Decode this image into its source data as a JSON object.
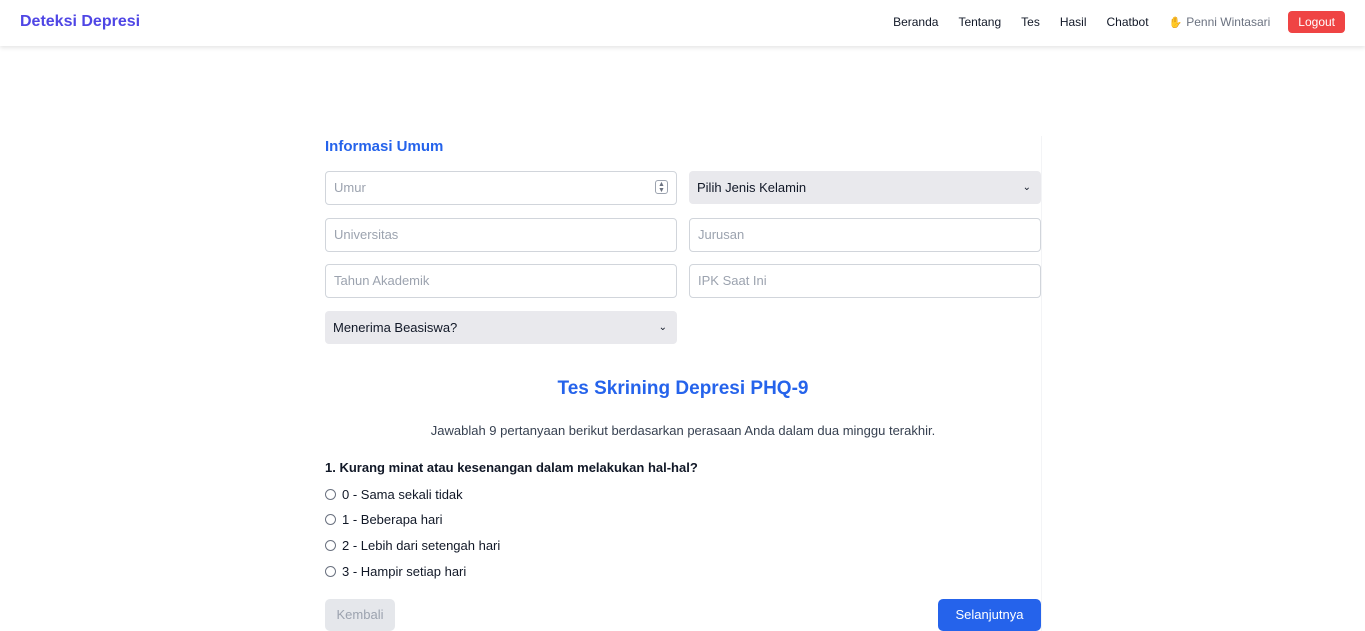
{
  "nav": {
    "brand": "Deteksi Depresi",
    "links": [
      "Beranda",
      "Tentang",
      "Tes",
      "Hasil",
      "Chatbot"
    ],
    "user": "Penni Wintasari",
    "user_icon": "waving-hand-icon",
    "logout": "Logout"
  },
  "form": {
    "section_title": "Informasi Umum",
    "age_placeholder": "Umur",
    "gender_select": "Pilih Jenis Kelamin",
    "university_placeholder": "Universitas",
    "major_placeholder": "Jurusan",
    "year_placeholder": "Tahun Akademik",
    "gpa_placeholder": "IPK Saat Ini",
    "scholarship_select": "Menerima Beasiswa?"
  },
  "test": {
    "title": "Tes Skrining Depresi PHQ-9",
    "description": "Jawablah 9 pertanyaan berikut berdasarkan perasaan Anda dalam dua minggu terakhir.",
    "question": "1. Kurang minat atau kesenangan dalam melakukan hal-hal?",
    "options": [
      "0 - Sama sekali tidak",
      "1 - Beberapa hari",
      "2 - Lebih dari setengah hari",
      "3 - Hampir setiap hari"
    ],
    "back": "Kembali",
    "next": "Selanjutnya"
  },
  "colors": {
    "brand": "#4f46e5",
    "accent": "#2563eb",
    "logout": "#ef4444"
  }
}
